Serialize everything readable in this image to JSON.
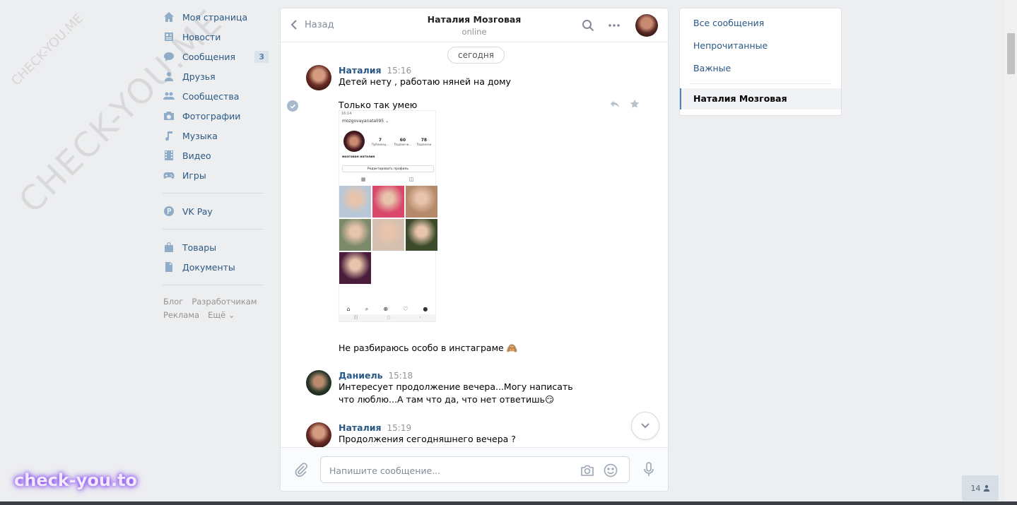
{
  "nav": {
    "items": [
      {
        "label": "Моя страница",
        "icon": "home-icon"
      },
      {
        "label": "Новости",
        "icon": "news-icon"
      },
      {
        "label": "Сообщения",
        "icon": "messages-icon",
        "badge": "3"
      },
      {
        "label": "Друзья",
        "icon": "friends-icon"
      },
      {
        "label": "Сообщества",
        "icon": "communities-icon"
      },
      {
        "label": "Фотографии",
        "icon": "camera-icon"
      },
      {
        "label": "Музыка",
        "icon": "music-icon"
      },
      {
        "label": "Видео",
        "icon": "video-icon"
      },
      {
        "label": "Игры",
        "icon": "gamepad-icon"
      }
    ],
    "pay": {
      "label": "VK Pay",
      "icon": "vkpay-icon"
    },
    "extra": [
      {
        "label": "Товары",
        "icon": "bag-icon"
      },
      {
        "label": "Документы",
        "icon": "document-icon"
      }
    ],
    "footer": [
      "Блог",
      "Разработчикам",
      "Реклама",
      "Ещё ⌄"
    ]
  },
  "chat": {
    "back_label": "Назад",
    "peer_name": "Наталия Мозговая",
    "peer_status": "online",
    "date_label": "сегодня",
    "messages": [
      {
        "author": "Наталия",
        "time": "15:16",
        "text": "Детей нету , работаю няней на дому"
      },
      {
        "text": "Только так умею"
      },
      {
        "text": "Не разбираюсь особо в инстаграме 🙈"
      },
      {
        "author": "Даниель",
        "time": "15:18",
        "text": "Интересует продолжение вечера...Могу написать что люблю...А там что да, что нет ответишь😏"
      },
      {
        "author": "Наталия",
        "time": "15:19",
        "text": "Продолжения сегодняшнего вечера ?"
      }
    ],
    "screenshot": {
      "status_time": "16:14",
      "username": "mozgovayanatali95 ⌄",
      "posts": "7",
      "posts_label": "Публикац...",
      "followers": "60",
      "followers_label": "Подписчи...",
      "following": "78",
      "following_label": "Подписки",
      "bio": "мозговая наталия",
      "edit_label": "Редактировать профиль",
      "tiles": [
        "#b8c8d8",
        "#d9486a",
        "#b48a6a",
        "#7a8a6a",
        "#d4c0b0",
        "#3a4a2a",
        "#4a1c3a"
      ]
    },
    "composer_placeholder": "Напишите сообщение..."
  },
  "filters": {
    "all": "Все сообщения",
    "unread": "Непрочитанные",
    "important": "Важные",
    "active": "Наталия Мозговая"
  },
  "online_count": "14",
  "watermark": {
    "diag": "CHECK-YOU.ME",
    "small": "CHECK-YOU.ME",
    "brand": "check-you.to"
  }
}
